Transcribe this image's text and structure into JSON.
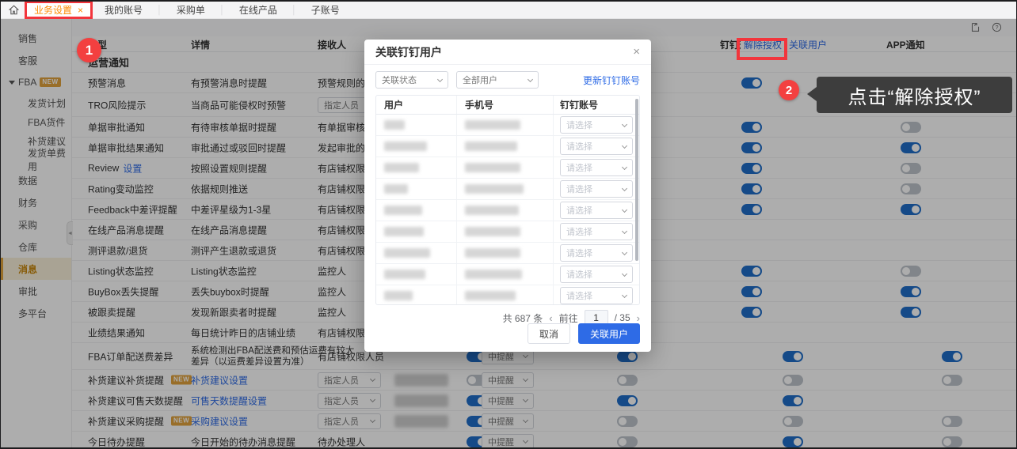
{
  "topnav": {
    "active_tab": {
      "label": "业务设置",
      "close": "×"
    },
    "items": [
      "我的账号",
      "采购单",
      "在线产品",
      "子账号"
    ]
  },
  "toolbar": {
    "icons": [
      "export-icon",
      "help-icon"
    ]
  },
  "icons": {
    "home": "⌂",
    "help": "?",
    "close": "×",
    "collapse": "◄",
    "prev": "‹",
    "next": "›"
  },
  "sidebar": {
    "items": [
      {
        "label": "销售"
      },
      {
        "label": "客服"
      },
      {
        "label": "FBA",
        "badge": "NEW",
        "expanded": true
      },
      {
        "label": "发货计划",
        "sub": true
      },
      {
        "label": "FBA货件",
        "sub": true
      },
      {
        "label": "补货建议",
        "sub": true
      },
      {
        "label": "发货单费用",
        "sub": true
      },
      {
        "label": "数据"
      },
      {
        "label": "财务"
      },
      {
        "label": "采购"
      },
      {
        "label": "仓库"
      },
      {
        "label": "消息",
        "active": true
      },
      {
        "label": "审批"
      },
      {
        "label": "多平台"
      }
    ]
  },
  "table": {
    "headers": {
      "type": "类型",
      "detail": "详情",
      "receiver": "接收人",
      "dingtalk": "钉钉通知",
      "unbind_link": "解除授权",
      "bind_link": "关联用户",
      "app": "APP通知"
    },
    "section": "运营通知",
    "rows": [
      {
        "name": "预警消息",
        "detail": "有预警消息时提醒",
        "receiver": "预警规则的通知人员",
        "dingtalk": "on"
      },
      {
        "name": "TRO风险提示",
        "detail": "当商品可能侵权时预警",
        "receiver_select": "指定人员",
        "tall_sel": true
      },
      {
        "name": "单据审批通知",
        "detail": "有待审核单据时提醒",
        "receiver": "有单据审核权限人员",
        "dingtalk": "on",
        "app": "off"
      },
      {
        "name": "单据审批结果通知",
        "detail": "审批通过或驳回时提醒",
        "receiver": "发起审批的人员",
        "dingtalk": "on",
        "app": "on"
      },
      {
        "name": "Review",
        "name_link": "设置",
        "detail": "按照设置规则提醒",
        "receiver": "有店铺权限人员",
        "dingtalk": "on",
        "app": "off"
      },
      {
        "name": "Rating变动监控",
        "detail": "依据规则推送",
        "receiver": "有店铺权限人员",
        "dingtalk": "on",
        "app": "off"
      },
      {
        "name": "Feedback中差评提醒",
        "detail": "中差评星级为1-3星",
        "receiver": "有店铺权限人员",
        "dingtalk": "on",
        "app": "on"
      },
      {
        "name": "在线产品消息提醒",
        "detail": "在线产品消息提醒",
        "receiver": "有店铺权限人员"
      },
      {
        "name": "测评退款/退货",
        "detail": "测评产生退款或退货",
        "receiver": "有店铺权限人员"
      },
      {
        "name": "Listing状态监控",
        "detail": "Listing状态监控",
        "receiver": "监控人",
        "dingtalk": "on",
        "app": "off"
      },
      {
        "name": "BuyBox丢失提醒",
        "detail": "丢失buybox时提醒",
        "receiver": "监控人",
        "dingtalk": "on",
        "app": "on"
      },
      {
        "name": "被跟卖提醒",
        "detail": "发现新跟卖者时提醒",
        "receiver": "监控人",
        "dingtalk": "on",
        "app": "on"
      },
      {
        "name": "业绩结果通知",
        "detail": "每日统计昨日的店铺业绩",
        "receiver": "有店铺权限人员"
      },
      {
        "name": "FBA订单配送费差异",
        "detail": "系统检测出FBA配送费和预估运费有较大差异（以运费差异设置为准）",
        "receiver": "有店铺权限人员",
        "notify": "on",
        "level": "中提醒",
        "extra": "on",
        "dingtalk": "on",
        "app": "on",
        "tall": true
      },
      {
        "name": "补货建议补货提醒",
        "badge": "NEW",
        "detail_link": "补货建议设置",
        "receiver_select": "指定人员",
        "blur": true,
        "notify": "off",
        "level": "中提醒",
        "extra": "off",
        "dingtalk": "off",
        "app": "off"
      },
      {
        "name": "补货建议可售天数提醒",
        "detail_link": "可售天数提醒设置",
        "receiver_select": "指定人员",
        "blur": true,
        "notify": "on",
        "level": "中提醒",
        "extra": "on",
        "dingtalk": "on"
      },
      {
        "name": "补货建议采购提醒",
        "badge": "NEW",
        "detail_link": "采购建议设置",
        "receiver_select": "指定人员",
        "blur": true,
        "notify": "on",
        "level": "中提醒",
        "extra": "off",
        "dingtalk": "off",
        "app": "off"
      },
      {
        "name": "今日待办提醒",
        "detail": "今日开始的待办消息提醒",
        "receiver": "待办处理人",
        "notify": "on",
        "level": "中提醒",
        "extra": "off",
        "dingtalk": "on",
        "app": "off"
      }
    ]
  },
  "modal": {
    "title": "关联钉钉用户",
    "close_icon": "×",
    "filters": {
      "status_select": "关联状态",
      "user_select": "全部用户",
      "refresh_link": "更新钉钉账号"
    },
    "columns": [
      "用户",
      "手机号",
      "钉钉账号"
    ],
    "select_placeholder": "请选择",
    "rows": [
      {
        "name_w": 26,
        "phone_w": 70
      },
      {
        "name_w": 54,
        "phone_w": 66
      },
      {
        "name_w": 44,
        "phone_w": 70
      },
      {
        "name_w": 30,
        "phone_w": 74
      },
      {
        "name_w": 48,
        "phone_w": 68
      },
      {
        "name_w": 50,
        "phone_w": 70
      },
      {
        "name_w": 58,
        "phone_w": 70
      },
      {
        "name_w": 52,
        "phone_w": 72
      },
      {
        "name_w": 36,
        "phone_w": 64
      }
    ],
    "pagination": {
      "total": "共 687 条",
      "prev": "‹",
      "goto_label": "前往",
      "page": "1",
      "total_pages": "/ 35",
      "next": "›"
    },
    "footer": {
      "cancel": "取消",
      "confirm": "关联用户"
    }
  },
  "annotations": {
    "step1": "1",
    "step2": "2",
    "tooltip": "点击“解除授权”"
  },
  "colors": {
    "accent_blue": "#2e6be6",
    "toggle_on": "#1f6ec9",
    "annotation_red": "#f2353c",
    "tab_orange": "#ff8a00",
    "sidebar_active_bg": "#faf1da"
  }
}
